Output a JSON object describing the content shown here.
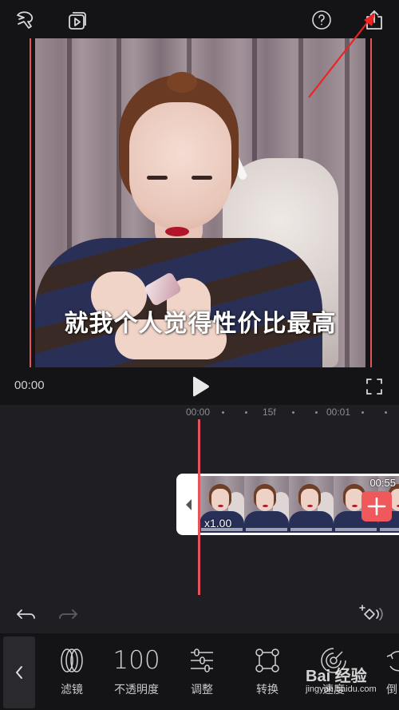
{
  "top_bar": {
    "icons": [
      "magic-effects-icon",
      "preview-playlist-icon",
      "help-icon",
      "export-share-icon"
    ]
  },
  "preview": {
    "subtitle": "就我个人觉得性价比最高",
    "current_time": "00:00",
    "play_icon": "play-icon",
    "fullscreen_icon": "fullscreen-icon",
    "accent_color": "#e5545a"
  },
  "timeline": {
    "ruler": {
      "labels": [
        "00:00",
        "15f",
        "00:01"
      ]
    },
    "clip": {
      "speed": "x1.00",
      "duration": "00:55",
      "frame_count": 5
    },
    "add_button_color": "#f0595b"
  },
  "edit_controls": {
    "undo_icon": "undo-icon",
    "redo_icon": "redo-icon",
    "keyframe_icon": "keyframe-add-icon"
  },
  "toolbar": {
    "back_icon": "chevron-left-icon",
    "items": [
      {
        "label": "滤镜",
        "icon": "filter-rings-icon"
      },
      {
        "label": "不透明度",
        "value": "100"
      },
      {
        "label": "调整",
        "icon": "sliders-icon"
      },
      {
        "label": "转换",
        "icon": "transform-icon"
      },
      {
        "label": "速度",
        "icon": "speed-gauge-icon"
      },
      {
        "label": "倒",
        "icon": "reverse-icon"
      }
    ]
  },
  "watermark": {
    "brand": "Bai  经验",
    "url": "jingyan.baidu.com"
  }
}
